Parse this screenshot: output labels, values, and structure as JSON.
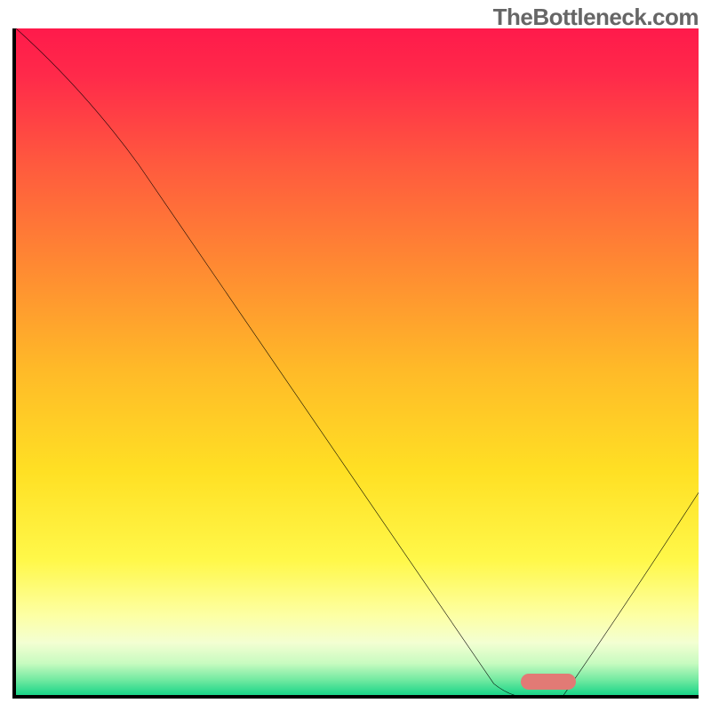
{
  "watermark": "TheBottleneck.com",
  "chart_data": {
    "type": "line",
    "title": "",
    "xlabel": "",
    "ylabel": "",
    "xlim": [
      0,
      100
    ],
    "ylim": [
      0,
      100
    ],
    "series": [
      {
        "name": "bottleneck-curve",
        "x": [
          0,
          18,
          70,
          75,
          80,
          100
        ],
        "y": [
          100,
          80,
          4,
          2,
          2,
          32
        ]
      }
    ],
    "marker": {
      "name": "optimal-range",
      "x_start": 74,
      "x_end": 82,
      "y": 2,
      "color": "#e27a75"
    },
    "gradient_stops": [
      {
        "offset": 0.0,
        "color": "#ff1a4b"
      },
      {
        "offset": 0.07,
        "color": "#ff2a4a"
      },
      {
        "offset": 0.2,
        "color": "#ff5a3e"
      },
      {
        "offset": 0.35,
        "color": "#ff8a32"
      },
      {
        "offset": 0.5,
        "color": "#ffba28"
      },
      {
        "offset": 0.65,
        "color": "#ffe024"
      },
      {
        "offset": 0.78,
        "color": "#fff84a"
      },
      {
        "offset": 0.86,
        "color": "#fdffa4"
      },
      {
        "offset": 0.9,
        "color": "#f3ffd2"
      },
      {
        "offset": 0.93,
        "color": "#c8fbc0"
      },
      {
        "offset": 0.955,
        "color": "#70e9a0"
      },
      {
        "offset": 0.975,
        "color": "#1fd68a"
      },
      {
        "offset": 1.0,
        "color": "#0fc97e"
      }
    ]
  }
}
